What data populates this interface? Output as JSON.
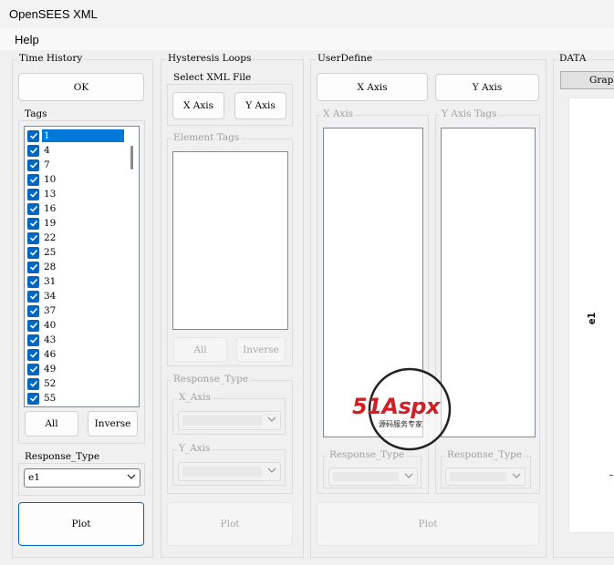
{
  "window": {
    "title": "OpenSEES XML"
  },
  "menu": {
    "help": "Help"
  },
  "time_history": {
    "label": "Time History",
    "ok": "OK",
    "tags_label": "Tags",
    "tags": [
      "1",
      "4",
      "7",
      "10",
      "13",
      "16",
      "19",
      "22",
      "25",
      "28",
      "31",
      "34",
      "37",
      "40",
      "43",
      "46",
      "49",
      "52",
      "55"
    ],
    "selected_tag": "1",
    "all": "All",
    "inverse": "Inverse",
    "response_type_label": "Response_Type",
    "response_type_value": "e1",
    "plot": "Plot"
  },
  "hysteresis": {
    "label": "Hysteresis Loops",
    "select_xml": "Select XML File",
    "x_axis": "X Axis",
    "y_axis": "Y Axis",
    "element_tags": "Element Tags",
    "all": "All",
    "inverse": "Inverse",
    "response_type": "Response_Type",
    "x_axis_combo": "X_Axis",
    "y_axis_combo": "Y_Axis",
    "plot": "Plot"
  },
  "user_define": {
    "label": "UserDefine",
    "x_axis_button": "X Axis",
    "y_axis_button": "Y Axis",
    "x_axis_group": "X Axis",
    "y_axis_tags_group": "Y Axis Tags",
    "response_type_left": "Response_Type",
    "response_type_right": "Response_Type",
    "plot": "Plot"
  },
  "data": {
    "label": "DATA",
    "graph_tab": "Graph",
    "axis_label": "e1"
  },
  "watermark": {
    "brand": "51Aspx",
    "sub": "源码服务专家"
  }
}
